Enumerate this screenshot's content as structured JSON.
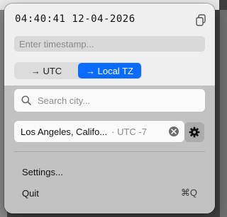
{
  "clock": {
    "display": "04:40:41 12-04-2026"
  },
  "timestamp_input": {
    "placeholder": "Enter timestamp...",
    "value": ""
  },
  "mode_toggle": {
    "options": [
      {
        "label": "→ UTC",
        "active": false
      },
      {
        "label": "→ Local TZ",
        "active": true
      }
    ]
  },
  "search": {
    "placeholder": "Search city...",
    "value": ""
  },
  "selected_city": {
    "name": "Los Angeles, Califo...",
    "offset": "· UTC -7"
  },
  "menu": {
    "settings_label": "Settings...",
    "quit_label": "Quit",
    "quit_shortcut": "⌘Q"
  },
  "icons": {
    "copy": "copy-icon",
    "search": "search-icon",
    "clear": "clear-icon",
    "gear": "gear-icon"
  },
  "colors": {
    "accent": "#0a6cff"
  }
}
